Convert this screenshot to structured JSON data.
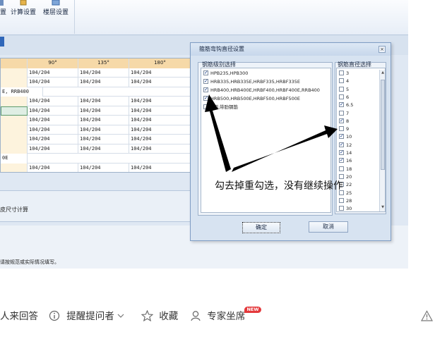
{
  "ribbon": {
    "calc_settings": "计算设置",
    "floor_settings": "楼层设置"
  },
  "grid": {
    "headers": [
      "",
      "90°",
      "135°",
      "180°"
    ],
    "rows": [
      [
        "",
        "104/204",
        "104/204",
        "104/204"
      ],
      [
        "",
        "104/204",
        "104/204",
        "104/204"
      ],
      [
        "E, RRB400",
        "",
        "",
        ""
      ],
      [
        "",
        "104/204",
        "104/204",
        "104/204"
      ],
      [
        "",
        "104/204",
        "104/204",
        "104/204"
      ],
      [
        "",
        "104/204",
        "104/204",
        "104/204"
      ],
      [
        "",
        "104/204",
        "104/204",
        "104/204"
      ],
      [
        "",
        "104/204",
        "104/204",
        "104/204"
      ],
      [
        "",
        "104/204",
        "104/204",
        "104/204"
      ],
      [
        "0E",
        "",
        "",
        ""
      ],
      [
        "",
        "104/204",
        "104/204",
        "104/204"
      ]
    ]
  },
  "lower": {
    "label": "皮尺寸计算"
  },
  "status": {
    "text": "请按规范或实际情况填写。"
  },
  "dialog": {
    "title": "箍筋弯钩直径设置",
    "close": "×",
    "types_group": "钢筋级别选择",
    "types": [
      {
        "label": "HPB235,HPB300",
        "checked": true
      },
      {
        "label": "HRB335,HRB335E,HRBF335,HRBF335E",
        "checked": true
      },
      {
        "label": "HRB400,HRB400E,HRBF400,HRBF400E,RRB400",
        "checked": true
      },
      {
        "label": "HRB500,HRB500E,HRBF500,HRBF500E",
        "checked": true
      },
      {
        "label": "冷轧带肋钢筋",
        "checked": false
      }
    ],
    "diam_group": "钢筋直径选择",
    "diameters": [
      {
        "label": "3",
        "checked": false
      },
      {
        "label": "4",
        "checked": false
      },
      {
        "label": "5",
        "checked": false
      },
      {
        "label": "6",
        "checked": false
      },
      {
        "label": "6.5",
        "checked": true
      },
      {
        "label": "7",
        "checked": false
      },
      {
        "label": "8",
        "checked": true
      },
      {
        "label": "9",
        "checked": false
      },
      {
        "label": "10",
        "checked": true
      },
      {
        "label": "12",
        "checked": true
      },
      {
        "label": "14",
        "checked": true
      },
      {
        "label": "16",
        "checked": true
      },
      {
        "label": "18",
        "checked": false
      },
      {
        "label": "20",
        "checked": false
      },
      {
        "label": "22",
        "checked": false
      },
      {
        "label": "25",
        "checked": false
      },
      {
        "label": "28",
        "checked": false
      },
      {
        "label": "30",
        "checked": false
      }
    ],
    "ok": "确定",
    "cancel": "取消"
  },
  "annotation": "勾去掉重勾选，没有继续操作",
  "qa_bar": {
    "answer": "人来回答",
    "remind": "提醒提问者",
    "favorite": "收藏",
    "expert": "专家坐席",
    "new_badge": "NEW"
  }
}
